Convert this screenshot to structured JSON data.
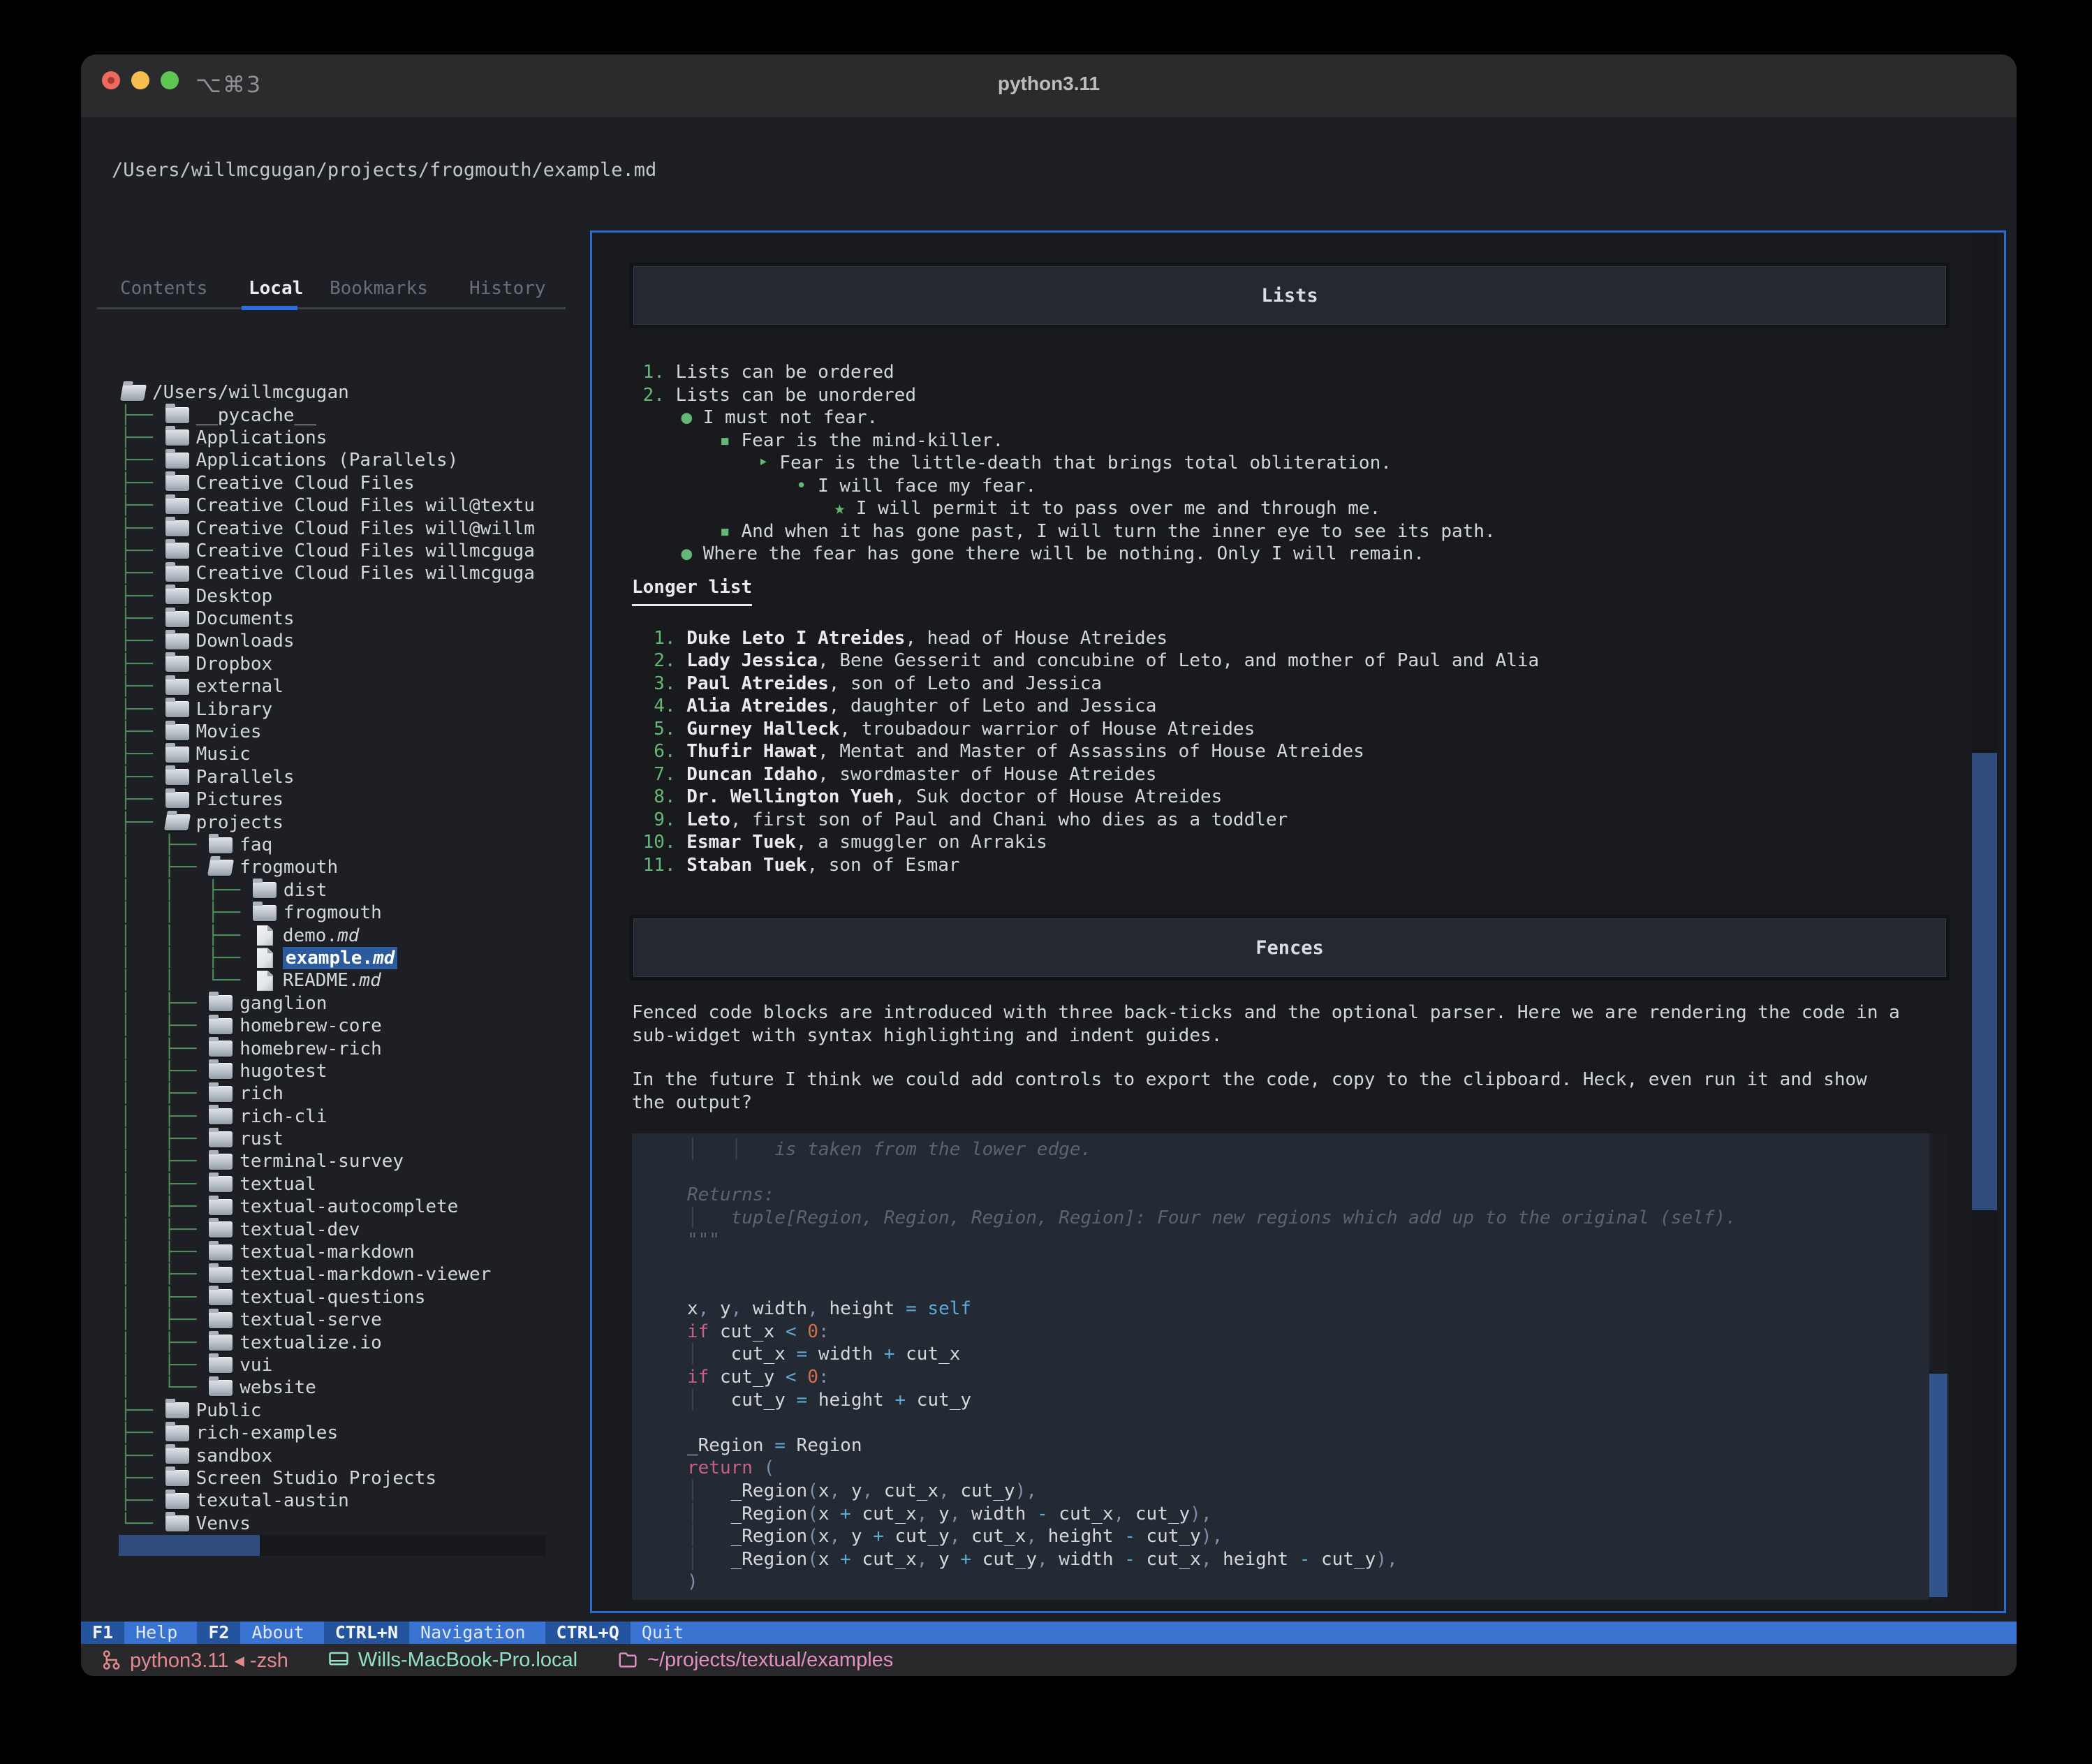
{
  "window": {
    "title": "python3.11",
    "shortcut": "⌥⌘3",
    "path": "/Users/willmcgugan/projects/frogmouth/example.md"
  },
  "colors": {
    "accent_blue": "#2b6ad0",
    "selection_blue": "#2b5a9d",
    "scroll_thumb": "#2e4d7d",
    "tree_green": "#4e8c59",
    "marker_green": "#63b877",
    "footer_key_bg": "#24549e",
    "footer_label_bg": "#3a74d2",
    "status_salmon": "#e2898e",
    "status_teal": "#93e2c3",
    "status_pink": "#e28fc2"
  },
  "sidebar": {
    "tabs": [
      {
        "label": "Contents",
        "active": false
      },
      {
        "label": "Local",
        "active": true
      },
      {
        "label": "Bookmarks",
        "active": false
      },
      {
        "label": "History",
        "active": false
      }
    ],
    "tree": [
      {
        "g": "",
        "i": "folder-open",
        "l": "/Users/willmcgugan"
      },
      {
        "g": "├── ",
        "i": "folder",
        "l": "__pycache__"
      },
      {
        "g": "├── ",
        "i": "folder",
        "l": "Applications"
      },
      {
        "g": "├── ",
        "i": "folder",
        "l": "Applications (Parallels)"
      },
      {
        "g": "├── ",
        "i": "folder",
        "l": "Creative Cloud Files"
      },
      {
        "g": "├── ",
        "i": "folder",
        "l": "Creative Cloud Files will@textu"
      },
      {
        "g": "├── ",
        "i": "folder",
        "l": "Creative Cloud Files will@willm"
      },
      {
        "g": "├── ",
        "i": "folder",
        "l": "Creative Cloud Files willmcguga"
      },
      {
        "g": "├── ",
        "i": "folder",
        "l": "Creative Cloud Files willmcguga"
      },
      {
        "g": "├── ",
        "i": "folder",
        "l": "Desktop"
      },
      {
        "g": "├── ",
        "i": "folder",
        "l": "Documents"
      },
      {
        "g": "├── ",
        "i": "folder",
        "l": "Downloads"
      },
      {
        "g": "├── ",
        "i": "folder",
        "l": "Dropbox"
      },
      {
        "g": "├── ",
        "i": "folder",
        "l": "external"
      },
      {
        "g": "├── ",
        "i": "folder",
        "l": "Library"
      },
      {
        "g": "├── ",
        "i": "folder",
        "l": "Movies"
      },
      {
        "g": "├── ",
        "i": "folder",
        "l": "Music"
      },
      {
        "g": "├── ",
        "i": "folder",
        "l": "Parallels"
      },
      {
        "g": "├── ",
        "i": "folder",
        "l": "Pictures"
      },
      {
        "g": "├── ",
        "i": "folder-open",
        "l": "projects"
      },
      {
        "g": "│   ├── ",
        "i": "folder",
        "l": "faq"
      },
      {
        "g": "│   ├── ",
        "i": "folder-open",
        "l": "frogmouth"
      },
      {
        "g": "│   │   ├── ",
        "i": "folder",
        "l": "dist"
      },
      {
        "g": "│   │   ├── ",
        "i": "folder",
        "l": "frogmouth"
      },
      {
        "g": "│   │   ├── ",
        "i": "file",
        "l": "demo.",
        "e": "md"
      },
      {
        "g": "│   │   ├── ",
        "i": "file",
        "l": "example.",
        "e": "md",
        "sel": true
      },
      {
        "g": "│   │   └── ",
        "i": "file",
        "l": "README.",
        "e": "md"
      },
      {
        "g": "│   ├── ",
        "i": "folder",
        "l": "ganglion"
      },
      {
        "g": "│   ├── ",
        "i": "folder",
        "l": "homebrew-core"
      },
      {
        "g": "│   ├── ",
        "i": "folder",
        "l": "homebrew-rich"
      },
      {
        "g": "│   ├── ",
        "i": "folder",
        "l": "hugotest"
      },
      {
        "g": "│   ├── ",
        "i": "folder",
        "l": "rich"
      },
      {
        "g": "│   ├── ",
        "i": "folder",
        "l": "rich-cli"
      },
      {
        "g": "│   ├── ",
        "i": "folder",
        "l": "rust"
      },
      {
        "g": "│   ├── ",
        "i": "folder",
        "l": "terminal-survey"
      },
      {
        "g": "│   ├── ",
        "i": "folder",
        "l": "textual"
      },
      {
        "g": "│   ├── ",
        "i": "folder",
        "l": "textual-autocomplete"
      },
      {
        "g": "│   ├── ",
        "i": "folder",
        "l": "textual-dev"
      },
      {
        "g": "│   ├── ",
        "i": "folder",
        "l": "textual-markdown"
      },
      {
        "g": "│   ├── ",
        "i": "folder",
        "l": "textual-markdown-viewer"
      },
      {
        "g": "│   ├── ",
        "i": "folder",
        "l": "textual-questions"
      },
      {
        "g": "│   ├── ",
        "i": "folder",
        "l": "textual-serve"
      },
      {
        "g": "│   ├── ",
        "i": "folder",
        "l": "textualize.io"
      },
      {
        "g": "│   ├── ",
        "i": "folder",
        "l": "vui"
      },
      {
        "g": "│   └── ",
        "i": "folder",
        "l": "website"
      },
      {
        "g": "├── ",
        "i": "folder",
        "l": "Public"
      },
      {
        "g": "├── ",
        "i": "folder",
        "l": "rich-examples"
      },
      {
        "g": "├── ",
        "i": "folder",
        "l": "sandbox"
      },
      {
        "g": "├── ",
        "i": "folder",
        "l": "Screen Studio Projects"
      },
      {
        "g": "├── ",
        "i": "folder",
        "l": "texutal-austin"
      },
      {
        "g": "└── ",
        "i": "folder",
        "l": "Venvs"
      }
    ]
  },
  "doc": {
    "h1_lists": "Lists",
    "list1": [
      {
        "i": 0,
        "m": "1.",
        "t": "Lists can be ordered"
      },
      {
        "i": 0,
        "m": "2.",
        "t": "Lists can be unordered"
      },
      {
        "i": 1,
        "m": "●",
        "t": "I must not fear."
      },
      {
        "i": 2,
        "m": "▪",
        "t": "Fear is the mind-killer."
      },
      {
        "i": 3,
        "m": "‣",
        "t": "Fear is the little-death that brings total obliteration."
      },
      {
        "i": 4,
        "m": "•",
        "t": "I will face my fear."
      },
      {
        "i": 5,
        "m": "★",
        "t": "I will permit it to pass over me and through me."
      },
      {
        "i": 2,
        "m": "▪",
        "t": "And when it has gone past, I will turn the inner eye to see its path."
      },
      {
        "i": 1,
        "m": "●",
        "t": "Where the fear has gone there will be nothing. Only I will remain."
      }
    ],
    "h2": "Longer list",
    "list2": [
      {
        "n": "1.",
        "b": "Duke Leto I Atreides",
        "r": ", head of House Atreides"
      },
      {
        "n": "2.",
        "b": "Lady Jessica",
        "r": ", Bene Gesserit and concubine of Leto, and mother of Paul and Alia"
      },
      {
        "n": "3.",
        "b": "Paul Atreides",
        "r": ", son of Leto and Jessica"
      },
      {
        "n": "4.",
        "b": "Alia Atreides",
        "r": ", daughter of Leto and Jessica"
      },
      {
        "n": "5.",
        "b": "Gurney Halleck",
        "r": ", troubadour warrior of House Atreides"
      },
      {
        "n": "6.",
        "b": "Thufir Hawat",
        "r": ", Mentat and Master of Assassins of House Atreides"
      },
      {
        "n": "7.",
        "b": "Duncan Idaho",
        "r": ", swordmaster of House Atreides"
      },
      {
        "n": "8.",
        "b": "Dr. Wellington Yueh",
        "r": ", Suk doctor of House Atreides"
      },
      {
        "n": "9.",
        "b": "Leto",
        "r": ", first son of Paul and Chani who dies as a toddler"
      },
      {
        "n": "10.",
        "b": "Esmar Tuek",
        "r": ", a smuggler on Arrakis"
      },
      {
        "n": "11.",
        "b": "Staban Tuek",
        "r": ", son of Esmar"
      }
    ],
    "h1_fences": "Fences",
    "para1": [
      "Fenced code blocks are introduced with three back-ticks and the optional parser. Here we are rendering the code in a",
      "sub-widget with syntax highlighting and indent guides."
    ],
    "para2": [
      "In the future I think we could add controls to export the code, copy to the clipboard. Heck, even run it and show",
      "the output?"
    ],
    "code": [
      [
        [
          "g",
          "│   │   "
        ],
        [
          "c",
          "is taken from the lower edge."
        ]
      ],
      [],
      [
        [
          "c",
          "Returns:"
        ]
      ],
      [
        [
          "g",
          "│   "
        ],
        [
          "c",
          "tuple[Region, Region, Region, Region]: Four new regions which add up to the original (self)."
        ]
      ],
      [
        [
          "c",
          "\"\"\""
        ]
      ],
      [],
      [],
      [
        [
          "p",
          "x"
        ],
        [
          "u",
          ", "
        ],
        [
          "p",
          "y"
        ],
        [
          "u",
          ", "
        ],
        [
          "p",
          "width"
        ],
        [
          "u",
          ", "
        ],
        [
          "p",
          "height"
        ],
        [
          "o",
          " = "
        ],
        [
          "s",
          "self"
        ]
      ],
      [
        [
          "k",
          "if "
        ],
        [
          "p",
          "cut_x"
        ],
        [
          "o",
          " < "
        ],
        [
          "n",
          "0"
        ],
        [
          "u",
          ":"
        ]
      ],
      [
        [
          "g",
          "│   "
        ],
        [
          "p",
          "cut_x"
        ],
        [
          "o",
          " = "
        ],
        [
          "p",
          "width"
        ],
        [
          "o",
          " + "
        ],
        [
          "p",
          "cut_x"
        ]
      ],
      [
        [
          "k",
          "if "
        ],
        [
          "p",
          "cut_y"
        ],
        [
          "o",
          " < "
        ],
        [
          "n",
          "0"
        ],
        [
          "u",
          ":"
        ]
      ],
      [
        [
          "g",
          "│   "
        ],
        [
          "p",
          "cut_y"
        ],
        [
          "o",
          " = "
        ],
        [
          "p",
          "height"
        ],
        [
          "o",
          " + "
        ],
        [
          "p",
          "cut_y"
        ]
      ],
      [],
      [
        [
          "p",
          "_Region"
        ],
        [
          "o",
          " = "
        ],
        [
          "p",
          "Region"
        ]
      ],
      [
        [
          "k",
          "return "
        ],
        [
          "u",
          "("
        ]
      ],
      [
        [
          "g",
          "│   "
        ],
        [
          "p",
          "_Region"
        ],
        [
          "u",
          "("
        ],
        [
          "p",
          "x"
        ],
        [
          "u",
          ", "
        ],
        [
          "p",
          "y"
        ],
        [
          "u",
          ", "
        ],
        [
          "p",
          "cut_x"
        ],
        [
          "u",
          ", "
        ],
        [
          "p",
          "cut_y"
        ],
        [
          "u",
          "),"
        ]
      ],
      [
        [
          "g",
          "│   "
        ],
        [
          "p",
          "_Region"
        ],
        [
          "u",
          "("
        ],
        [
          "p",
          "x"
        ],
        [
          "o",
          " + "
        ],
        [
          "p",
          "cut_x"
        ],
        [
          "u",
          ", "
        ],
        [
          "p",
          "y"
        ],
        [
          "u",
          ", "
        ],
        [
          "p",
          "width"
        ],
        [
          "o",
          " - "
        ],
        [
          "p",
          "cut_x"
        ],
        [
          "u",
          ", "
        ],
        [
          "p",
          "cut_y"
        ],
        [
          "u",
          "),"
        ]
      ],
      [
        [
          "g",
          "│   "
        ],
        [
          "p",
          "_Region"
        ],
        [
          "u",
          "("
        ],
        [
          "p",
          "x"
        ],
        [
          "u",
          ", "
        ],
        [
          "p",
          "y"
        ],
        [
          "o",
          " + "
        ],
        [
          "p",
          "cut_y"
        ],
        [
          "u",
          ", "
        ],
        [
          "p",
          "cut_x"
        ],
        [
          "u",
          ", "
        ],
        [
          "p",
          "height"
        ],
        [
          "o",
          " - "
        ],
        [
          "p",
          "cut_y"
        ],
        [
          "u",
          "),"
        ]
      ],
      [
        [
          "g",
          "│   "
        ],
        [
          "p",
          "_Region"
        ],
        [
          "u",
          "("
        ],
        [
          "p",
          "x"
        ],
        [
          "o",
          " + "
        ],
        [
          "p",
          "cut_x"
        ],
        [
          "u",
          ", "
        ],
        [
          "p",
          "y"
        ],
        [
          "o",
          " + "
        ],
        [
          "p",
          "cut_y"
        ],
        [
          "u",
          ", "
        ],
        [
          "p",
          "width"
        ],
        [
          "o",
          " - "
        ],
        [
          "p",
          "cut_x"
        ],
        [
          "u",
          ", "
        ],
        [
          "p",
          "height"
        ],
        [
          "o",
          " - "
        ],
        [
          "p",
          "cut_y"
        ],
        [
          "u",
          "),"
        ]
      ],
      [
        [
          "u",
          ")"
        ]
      ]
    ]
  },
  "footer": [
    {
      "key": "F1",
      "label": "Help"
    },
    {
      "key": "F2",
      "label": "About"
    },
    {
      "key": "CTRL+N",
      "label": "Navigation"
    },
    {
      "key": "CTRL+Q",
      "label": "Quit"
    }
  ],
  "statusbar": [
    {
      "icon": "branch-icon",
      "text": "python3.11 ◂ -zsh",
      "color": "#e2898e"
    },
    {
      "icon": "monitor-icon",
      "text": "Wills-MacBook-Pro.local",
      "color": "#93e2c3"
    },
    {
      "icon": "folder-outline-icon",
      "text": "~/projects/textual/examples",
      "color": "#e28fc2"
    }
  ]
}
